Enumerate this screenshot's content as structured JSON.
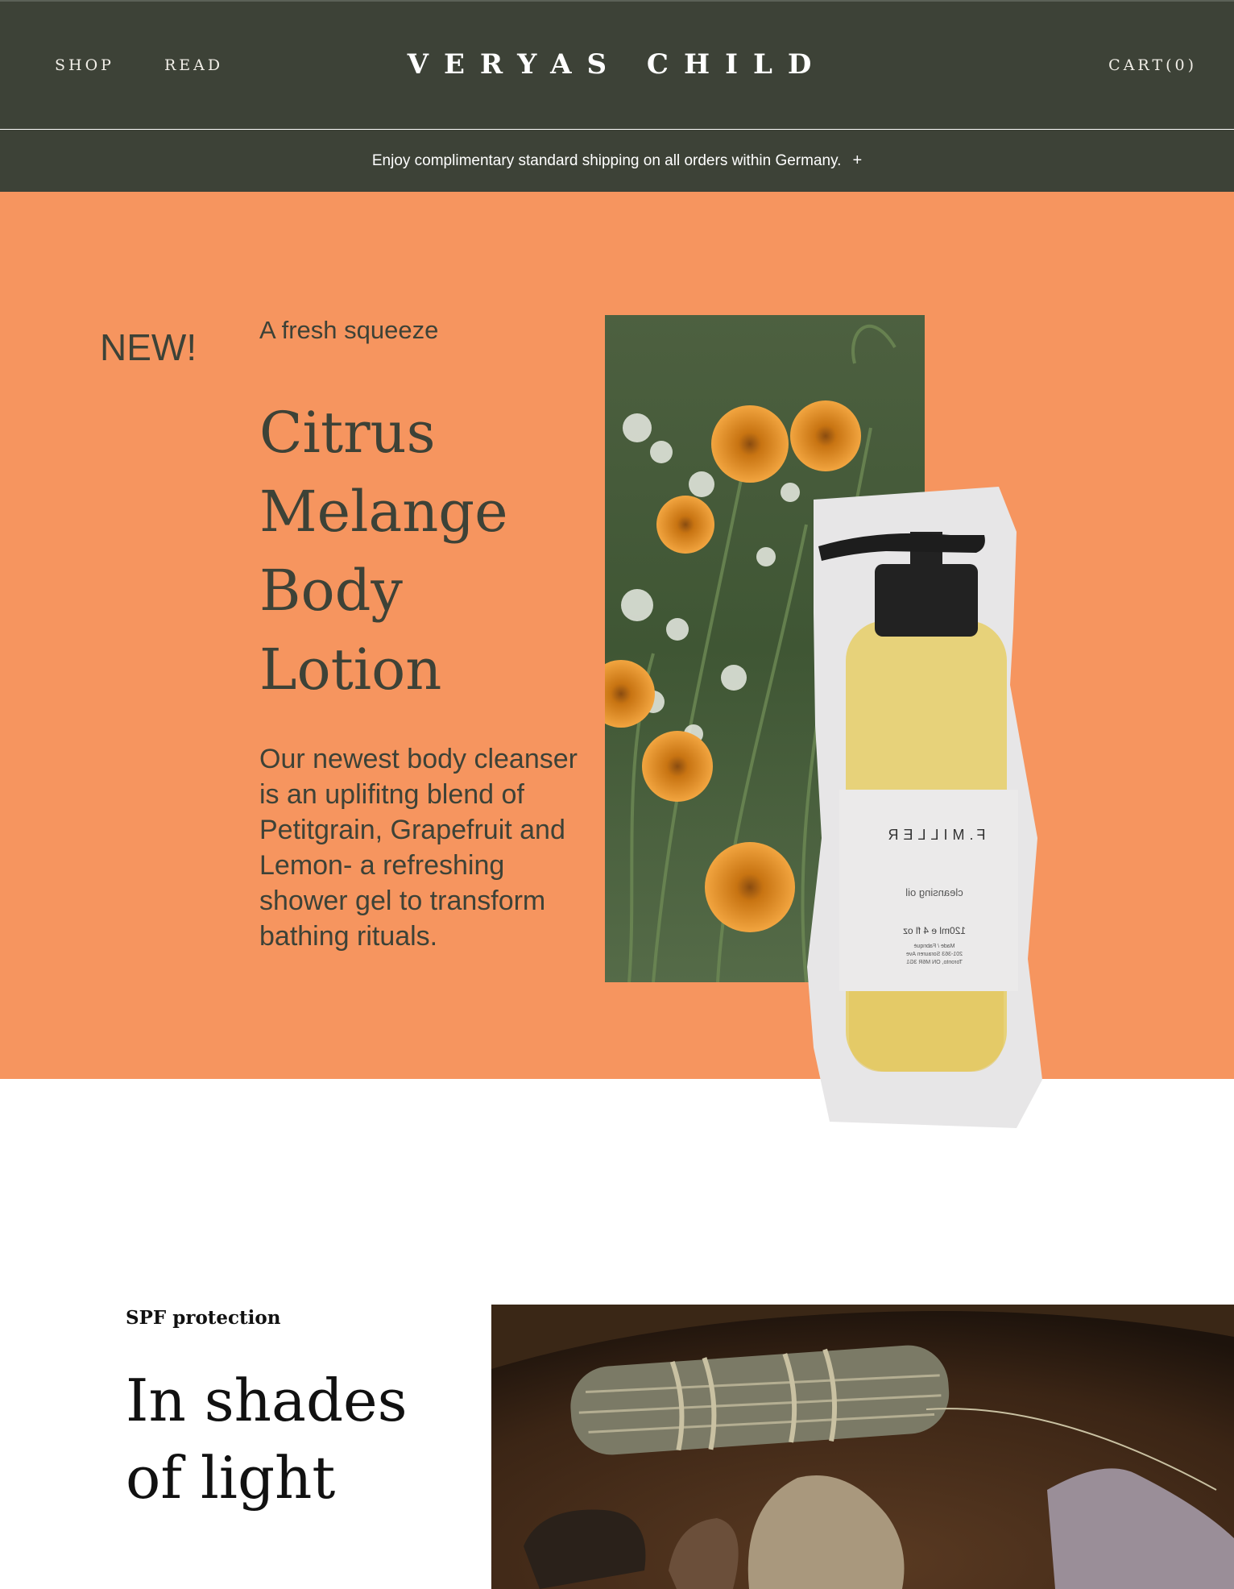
{
  "header": {
    "nav": {
      "shop": "SHOP",
      "read": "READ"
    },
    "brand": "VERYAS CHILD",
    "cart": "CART(0)"
  },
  "announcement": {
    "text": "Enjoy complimentary standard shipping on all orders within Germany.",
    "expand_icon": "+"
  },
  "hero": {
    "badge": "NEW!",
    "eyebrow": "A fresh squeeze",
    "title": "Citrus Melange Body Lotion",
    "description": "Our newest body cleanser is an uplifitng blend of Petitgrain, Grapefruit and Lemon- a refreshing shower gel to transform bathing rituals.",
    "bottle_label": {
      "brand": "F.MILLER",
      "product": "cleansing oil",
      "volume": "120ml e 4 fl oz",
      "address_1": "Made / Fabriqué",
      "address_2": "201-363 Sorauren Ave",
      "address_3": "Toronto, ON M6R 3G1"
    }
  },
  "feature": {
    "eyebrow": "SPF protection",
    "title": "In shades of light"
  },
  "colors": {
    "header_bg": "#3d4237",
    "hero_bg": "#f6955f",
    "text_dark": "#3d4237"
  }
}
